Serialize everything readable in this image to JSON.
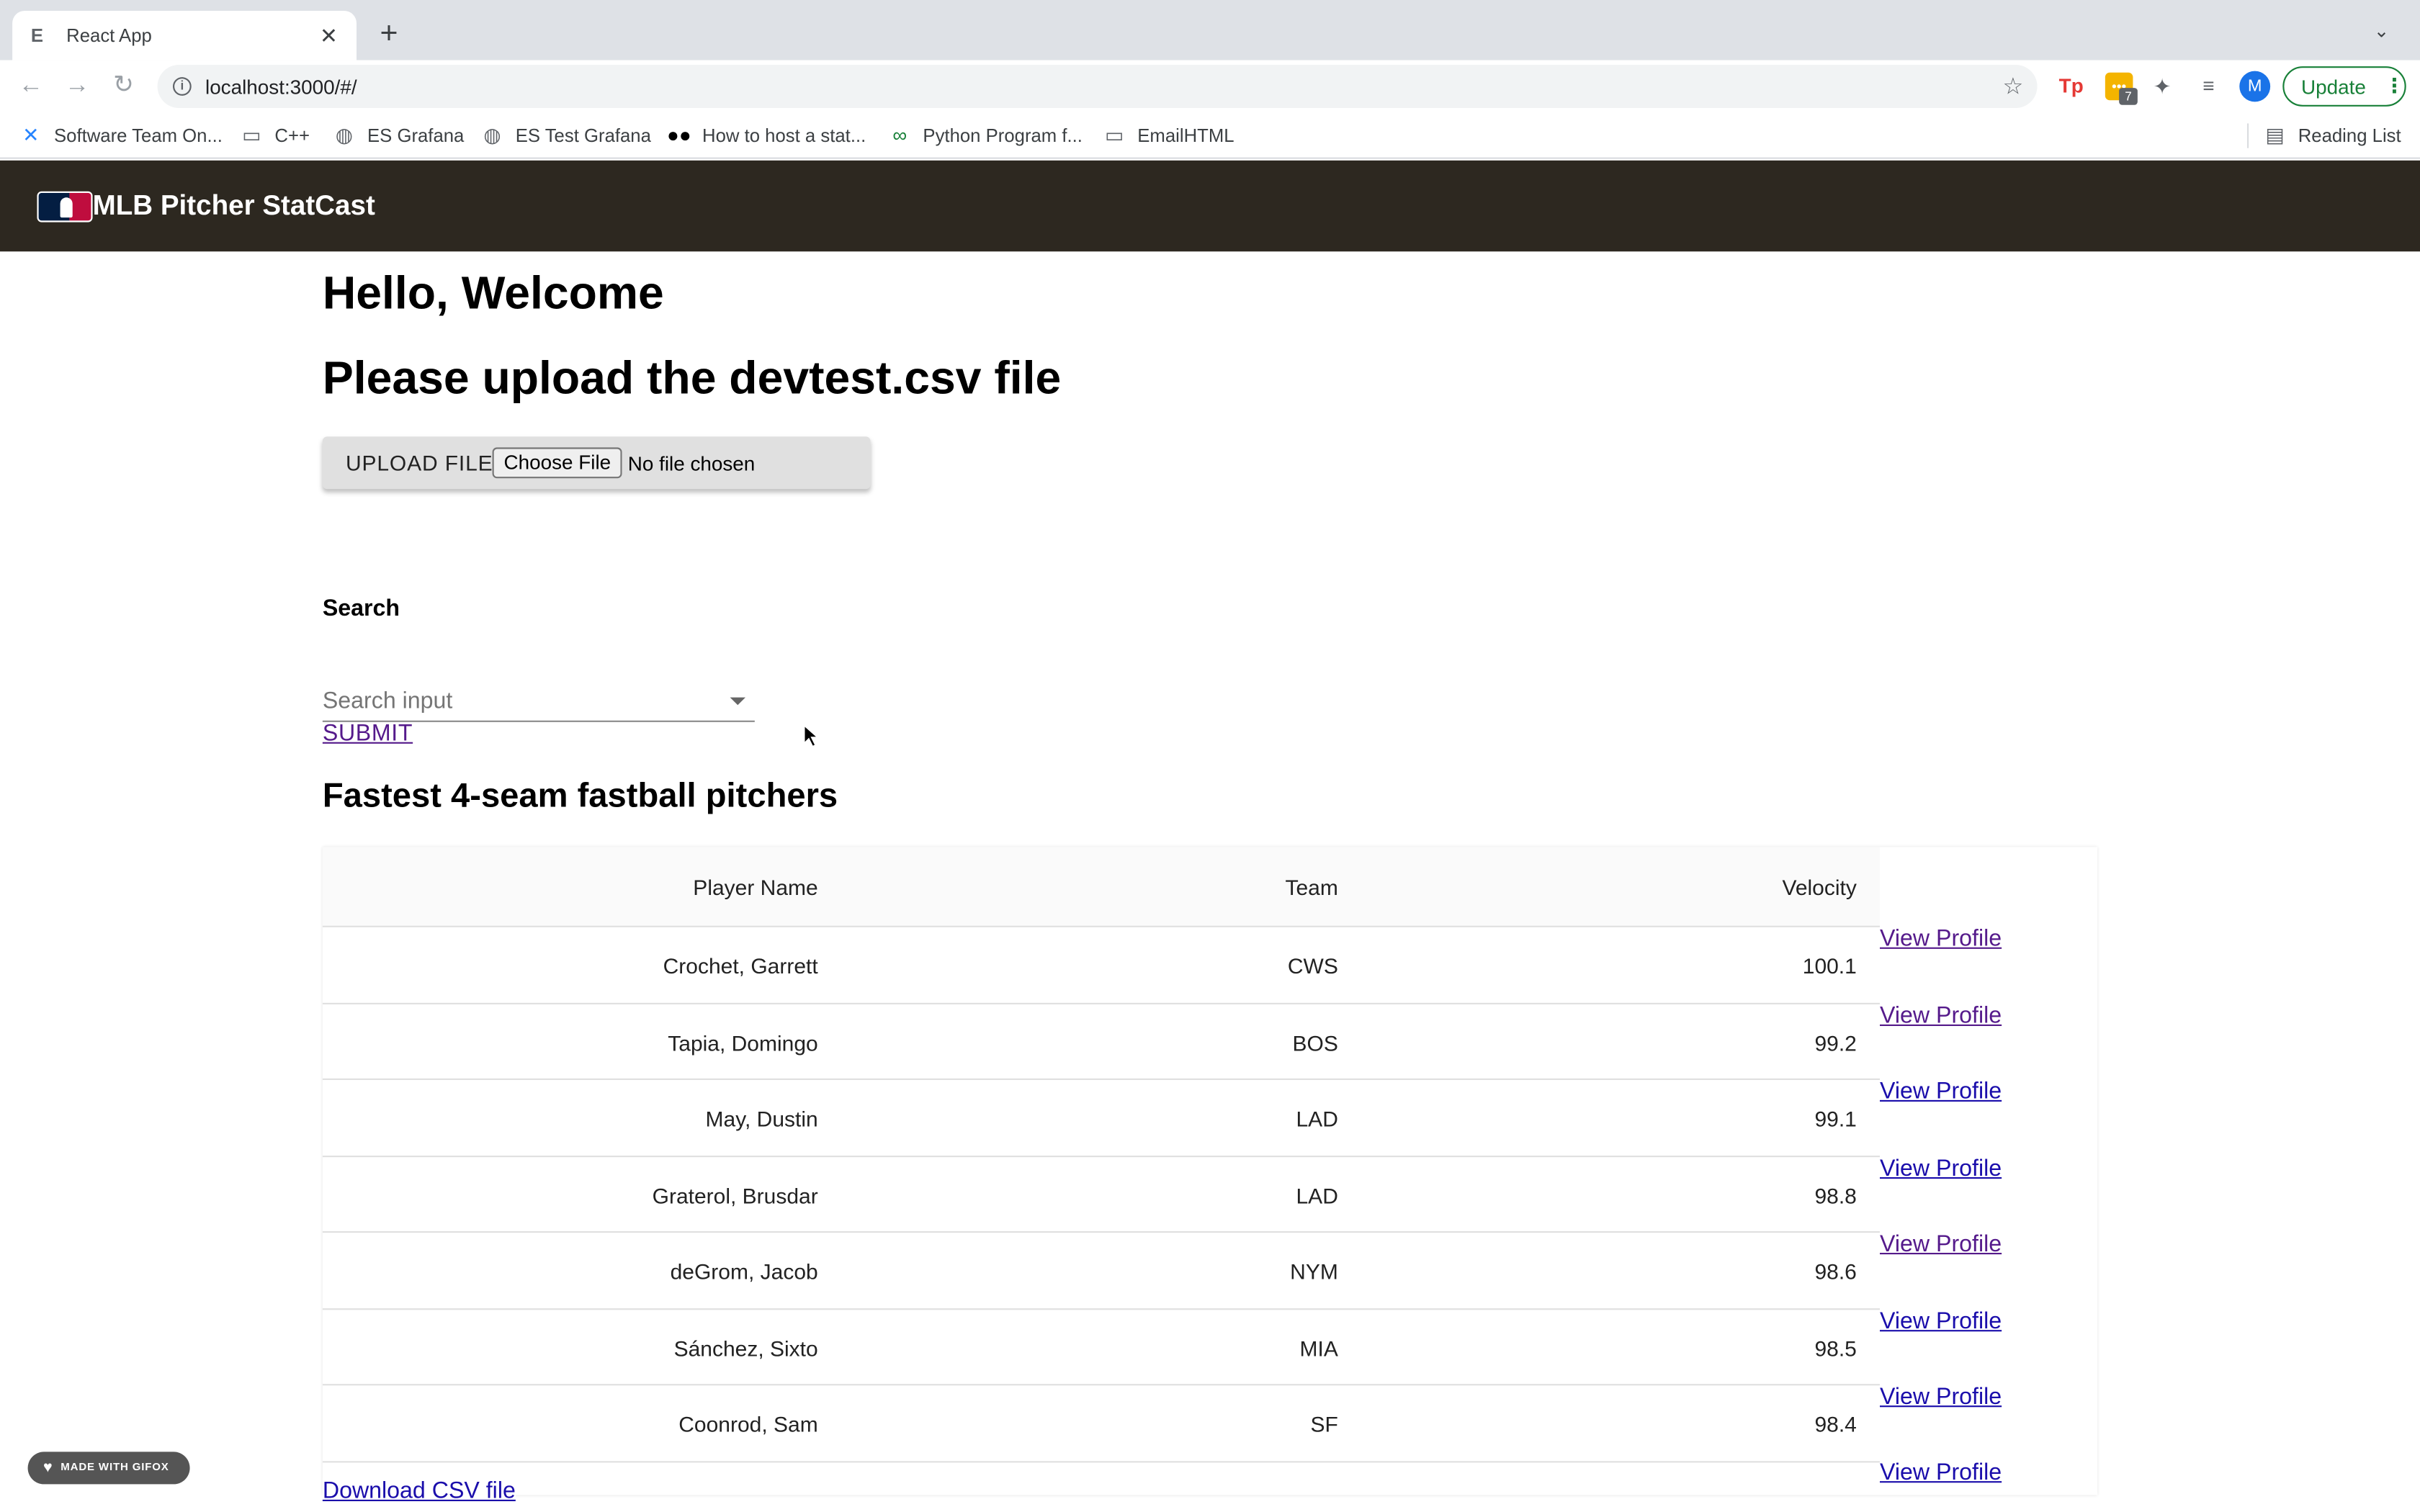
{
  "browser": {
    "tab_title": "React App",
    "tab_favicon": "react-favicon",
    "url": "localhost:3000/#/",
    "update_label": "Update",
    "avatar_letter": "M",
    "extension_badge": "7",
    "bookmarks": [
      {
        "label": "Software Team On...",
        "icon": "confluence-icon"
      },
      {
        "label": "C++",
        "icon": "folder-icon"
      },
      {
        "label": "ES Grafana",
        "icon": "globe-icon"
      },
      {
        "label": "ES Test Grafana",
        "icon": "globe-icon"
      },
      {
        "label": "How to host a stat...",
        "icon": "medium-icon"
      },
      {
        "label": "Python Program f...",
        "icon": "python-icon"
      },
      {
        "label": "EmailHTML",
        "icon": "folder-icon"
      }
    ],
    "reading_list": "Reading List"
  },
  "app": {
    "title": "MLB Pitcher StatCast",
    "header_color": "#2d2820",
    "welcome": "Hello, Welcome",
    "upload_heading": "Please upload the devtest.csv file",
    "upload_label": "UPLOAD FILE",
    "choose_file": "Choose File",
    "no_file": "No file chosen",
    "search_label": "Search",
    "search_placeholder": "Search input",
    "submit_label": "SUBMIT",
    "table_heading": "Fastest 4-seam fastball pitchers",
    "columns": [
      "Player Name",
      "Team",
      "Velocity"
    ],
    "rows": [
      {
        "name": "Crochet, Garrett",
        "team": "CWS",
        "velocity": "100.1",
        "link": "View Profile",
        "visited": true
      },
      {
        "name": "Tapia, Domingo",
        "team": "BOS",
        "velocity": "99.2",
        "link": "View Profile",
        "visited": true
      },
      {
        "name": "May, Dustin",
        "team": "LAD",
        "velocity": "99.1",
        "link": "View Profile",
        "visited": false
      },
      {
        "name": "Graterol, Brusdar",
        "team": "LAD",
        "velocity": "98.8",
        "link": "View Profile",
        "visited": false
      },
      {
        "name": "deGrom, Jacob",
        "team": "NYM",
        "velocity": "98.6",
        "link": "View Profile",
        "visited": true
      },
      {
        "name": "Sánchez, Sixto",
        "team": "MIA",
        "velocity": "98.5",
        "link": "View Profile",
        "visited": false
      },
      {
        "name": "Coonrod, Sam",
        "team": "SF",
        "velocity": "98.4",
        "link": "View Profile",
        "visited": false
      }
    ],
    "extra_link": "View Profile",
    "download_label": "Download CSV file"
  },
  "overlay": {
    "gifox_label": "MADE WITH GIFOX"
  }
}
